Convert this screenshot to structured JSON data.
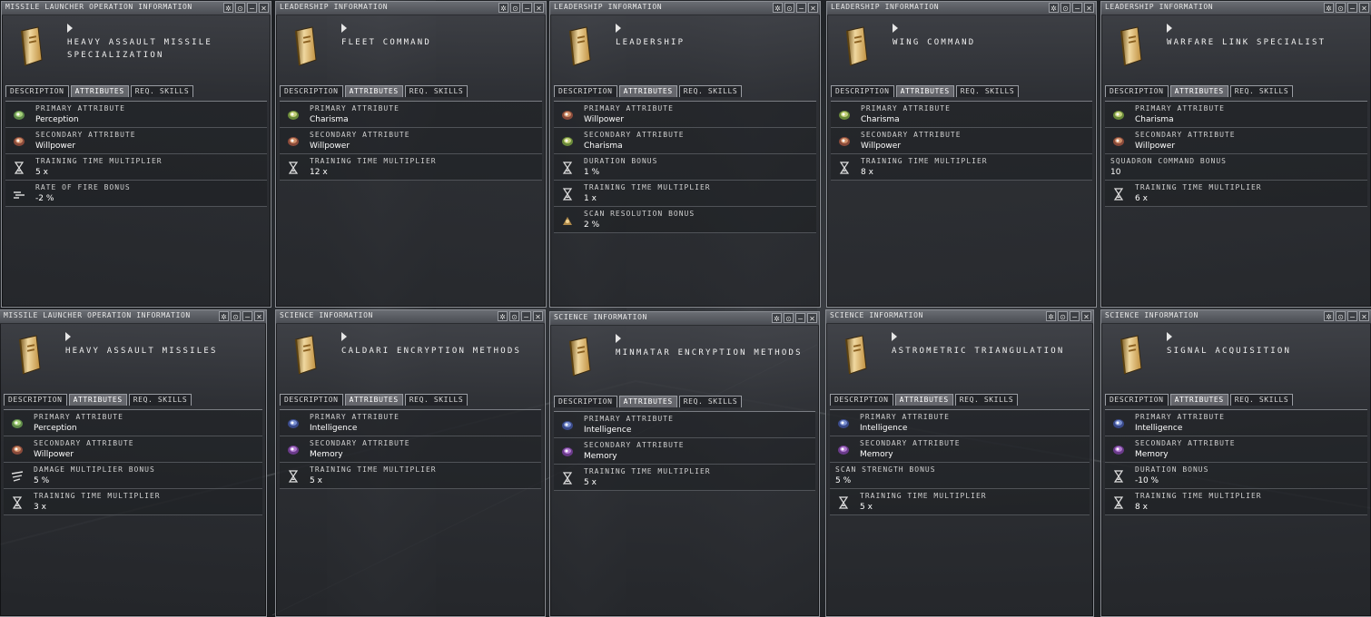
{
  "title_buttons": [
    "✲",
    "⊙",
    "−",
    "✕"
  ],
  "windows": [
    {
      "title": "MISSILE LAUNCHER OPERATION INFORMATION",
      "name": "HEAVY ASSAULT MISSILE\nSPECIALIZATION",
      "tabs": [
        "DESCRIPTION",
        "ATTRIBUTES",
        "REQ. SKILLS"
      ],
      "active_tab": 1,
      "rows": [
        {
          "icon": "perception-icon",
          "label": "PRIMARY ATTRIBUTE",
          "value": "Perception"
        },
        {
          "icon": "willpower-icon",
          "label": "SECONDARY ATTRIBUTE",
          "value": "Willpower"
        },
        {
          "icon": "hourglass-icon",
          "label": "TRAINING TIME MULTIPLIER",
          "value": "5 x"
        },
        {
          "icon": "rate-of-fire-icon",
          "label": "RATE OF FIRE BONUS",
          "value": "-2 %"
        }
      ]
    },
    {
      "title": "LEADERSHIP INFORMATION",
      "name": "FLEET COMMAND",
      "tabs": [
        "DESCRIPTION",
        "ATTRIBUTES",
        "REQ. SKILLS"
      ],
      "active_tab": 1,
      "rows": [
        {
          "icon": "charisma-icon",
          "label": "PRIMARY ATTRIBUTE",
          "value": "Charisma"
        },
        {
          "icon": "willpower-icon",
          "label": "SECONDARY ATTRIBUTE",
          "value": "Willpower"
        },
        {
          "icon": "hourglass-icon",
          "label": "TRAINING TIME MULTIPLIER",
          "value": "12 x"
        }
      ]
    },
    {
      "title": "LEADERSHIP INFORMATION",
      "name": "LEADERSHIP",
      "tabs": [
        "DESCRIPTION",
        "ATTRIBUTES",
        "REQ. SKILLS"
      ],
      "active_tab": 1,
      "rows": [
        {
          "icon": "willpower-icon",
          "label": "PRIMARY ATTRIBUTE",
          "value": "Willpower"
        },
        {
          "icon": "charisma-icon",
          "label": "SECONDARY ATTRIBUTE",
          "value": "Charisma"
        },
        {
          "icon": "hourglass-icon",
          "label": "DURATION BONUS",
          "value": "1 %"
        },
        {
          "icon": "hourglass-icon",
          "label": "TRAINING TIME MULTIPLIER",
          "value": "1 x"
        },
        {
          "icon": "scan-resolution-icon",
          "label": "SCAN RESOLUTION BONUS",
          "value": "2 %"
        }
      ]
    },
    {
      "title": "LEADERSHIP INFORMATION",
      "name": "WING COMMAND",
      "tabs": [
        "DESCRIPTION",
        "ATTRIBUTES",
        "REQ. SKILLS"
      ],
      "active_tab": 1,
      "rows": [
        {
          "icon": "charisma-icon",
          "label": "PRIMARY ATTRIBUTE",
          "value": "Charisma"
        },
        {
          "icon": "willpower-icon",
          "label": "SECONDARY ATTRIBUTE",
          "value": "Willpower"
        },
        {
          "icon": "hourglass-icon",
          "label": "TRAINING TIME MULTIPLIER",
          "value": "8 x"
        }
      ]
    },
    {
      "title": "LEADERSHIP INFORMATION",
      "name": "WARFARE LINK SPECIALIST",
      "tabs": [
        "DESCRIPTION",
        "ATTRIBUTES",
        "REQ. SKILLS"
      ],
      "active_tab": 1,
      "rows": [
        {
          "icon": "charisma-icon",
          "label": "PRIMARY ATTRIBUTE",
          "value": "Charisma"
        },
        {
          "icon": "willpower-icon",
          "label": "SECONDARY ATTRIBUTE",
          "value": "Willpower"
        },
        {
          "icon": "",
          "label": "SQUADRON COMMAND BONUS",
          "value": "10"
        },
        {
          "icon": "hourglass-icon",
          "label": "TRAINING TIME MULTIPLIER",
          "value": "6 x"
        }
      ]
    },
    {
      "title": "MISSILE LAUNCHER OPERATION INFORMATION",
      "name": "HEAVY ASSAULT MISSILES",
      "tabs": [
        "DESCRIPTION",
        "ATTRIBUTES",
        "REQ. SKILLS"
      ],
      "active_tab": 1,
      "rows": [
        {
          "icon": "perception-icon",
          "label": "PRIMARY ATTRIBUTE",
          "value": "Perception"
        },
        {
          "icon": "willpower-icon",
          "label": "SECONDARY ATTRIBUTE",
          "value": "Willpower"
        },
        {
          "icon": "damage-multiplier-icon",
          "label": "DAMAGE MULTIPLIER BONUS",
          "value": "5 %"
        },
        {
          "icon": "hourglass-icon",
          "label": "TRAINING TIME MULTIPLIER",
          "value": "3 x"
        }
      ]
    },
    {
      "title": "SCIENCE INFORMATION",
      "name": "CALDARI ENCRYPTION METHODS",
      "tabs": [
        "DESCRIPTION",
        "ATTRIBUTES",
        "REQ. SKILLS"
      ],
      "active_tab": 1,
      "rows": [
        {
          "icon": "intelligence-icon",
          "label": "PRIMARY ATTRIBUTE",
          "value": "Intelligence"
        },
        {
          "icon": "memory-icon",
          "label": "SECONDARY ATTRIBUTE",
          "value": "Memory"
        },
        {
          "icon": "hourglass-icon",
          "label": "TRAINING TIME MULTIPLIER",
          "value": "5 x"
        }
      ]
    },
    {
      "title": "SCIENCE INFORMATION",
      "name": "MINMATAR ENCRYPTION METHODS",
      "tabs": [
        "DESCRIPTION",
        "ATTRIBUTES",
        "REQ. SKILLS"
      ],
      "active_tab": 1,
      "rows": [
        {
          "icon": "intelligence-icon",
          "label": "PRIMARY ATTRIBUTE",
          "value": "Intelligence"
        },
        {
          "icon": "memory-icon",
          "label": "SECONDARY ATTRIBUTE",
          "value": "Memory"
        },
        {
          "icon": "hourglass-icon",
          "label": "TRAINING TIME MULTIPLIER",
          "value": "5 x"
        }
      ]
    },
    {
      "title": "SCIENCE INFORMATION",
      "name": "ASTROMETRIC TRIANGULATION",
      "tabs": [
        "DESCRIPTION",
        "ATTRIBUTES",
        "REQ. SKILLS"
      ],
      "active_tab": 1,
      "rows": [
        {
          "icon": "intelligence-icon",
          "label": "PRIMARY ATTRIBUTE",
          "value": "Intelligence"
        },
        {
          "icon": "memory-icon",
          "label": "SECONDARY ATTRIBUTE",
          "value": "Memory"
        },
        {
          "icon": "",
          "label": "SCAN STRENGTH BONUS",
          "value": "5 %"
        },
        {
          "icon": "hourglass-icon",
          "label": "TRAINING TIME MULTIPLIER",
          "value": "5 x"
        }
      ]
    },
    {
      "title": "SCIENCE INFORMATION",
      "name": "SIGNAL ACQUISITION",
      "tabs": [
        "DESCRIPTION",
        "ATTRIBUTES",
        "REQ. SKILLS"
      ],
      "active_tab": 1,
      "rows": [
        {
          "icon": "intelligence-icon",
          "label": "PRIMARY ATTRIBUTE",
          "value": "Intelligence"
        },
        {
          "icon": "memory-icon",
          "label": "SECONDARY ATTRIBUTE",
          "value": "Memory"
        },
        {
          "icon": "hourglass-icon",
          "label": "DURATION BONUS",
          "value": "-10 %"
        },
        {
          "icon": "hourglass-icon",
          "label": "TRAINING TIME MULTIPLIER",
          "value": "8 x"
        }
      ]
    }
  ]
}
